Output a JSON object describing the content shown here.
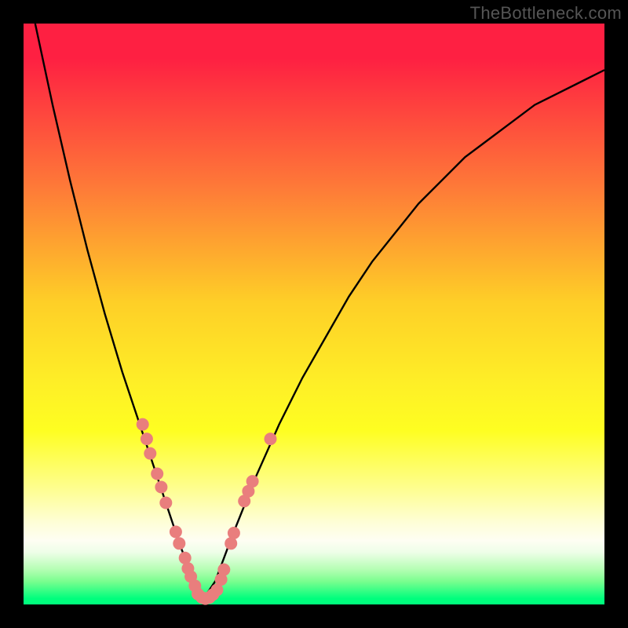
{
  "watermark": "TheBottleneck.com",
  "chart_data": {
    "type": "line",
    "title": "",
    "xlabel": "",
    "ylabel": "",
    "xlim": [
      0,
      100
    ],
    "ylim": [
      0,
      100
    ],
    "grid": false,
    "legend": false,
    "series": [
      {
        "name": "bottleneck-curve",
        "color": "#000000",
        "x": [
          2,
          5,
          8,
          11,
          14,
          17,
          19,
          21,
          23,
          25,
          27,
          29,
          31,
          33,
          36,
          40,
          44,
          48,
          52,
          56,
          60,
          64,
          68,
          72,
          76,
          80,
          84,
          88,
          92,
          96,
          100
        ],
        "y": [
          100,
          86,
          73,
          61,
          50,
          40,
          34,
          28,
          22,
          16,
          10,
          5,
          1,
          4,
          12,
          22,
          31,
          39,
          46,
          53,
          59,
          64,
          69,
          73,
          77,
          80,
          83,
          86,
          88,
          90,
          92
        ]
      }
    ],
    "scatter_clusters": [
      {
        "name": "left-arm-points",
        "color": "#e97e7d",
        "radius": 8,
        "points": [
          {
            "x": 20.5,
            "y": 31.0
          },
          {
            "x": 21.2,
            "y": 28.5
          },
          {
            "x": 21.8,
            "y": 26.0
          },
          {
            "x": 23.0,
            "y": 22.5
          },
          {
            "x": 23.7,
            "y": 20.2
          },
          {
            "x": 24.5,
            "y": 17.5
          },
          {
            "x": 26.2,
            "y": 12.5
          },
          {
            "x": 26.8,
            "y": 10.5
          },
          {
            "x": 27.8,
            "y": 8.0
          },
          {
            "x": 28.3,
            "y": 6.2
          },
          {
            "x": 28.8,
            "y": 4.8
          },
          {
            "x": 29.5,
            "y": 3.2
          }
        ]
      },
      {
        "name": "valley-points",
        "color": "#e97e7d",
        "radius": 8,
        "points": [
          {
            "x": 30.0,
            "y": 1.8
          },
          {
            "x": 30.7,
            "y": 1.2
          },
          {
            "x": 31.3,
            "y": 1.0
          },
          {
            "x": 32.0,
            "y": 1.2
          },
          {
            "x": 32.6,
            "y": 1.7
          },
          {
            "x": 33.3,
            "y": 2.5
          }
        ]
      },
      {
        "name": "right-arm-points",
        "color": "#e97e7d",
        "radius": 8,
        "points": [
          {
            "x": 34.0,
            "y": 4.3
          },
          {
            "x": 34.5,
            "y": 6.0
          },
          {
            "x": 35.7,
            "y": 10.5
          },
          {
            "x": 36.2,
            "y": 12.3
          },
          {
            "x": 38.0,
            "y": 17.8
          },
          {
            "x": 38.7,
            "y": 19.5
          },
          {
            "x": 39.4,
            "y": 21.2
          },
          {
            "x": 42.5,
            "y": 28.5
          }
        ]
      }
    ],
    "gradient_stops": [
      {
        "pos": 0.0,
        "color": "#fe2042"
      },
      {
        "pos": 0.28,
        "color": "#fe7938"
      },
      {
        "pos": 0.48,
        "color": "#fecf27"
      },
      {
        "pos": 0.7,
        "color": "#fefe21"
      },
      {
        "pos": 0.86,
        "color": "#fefed8"
      },
      {
        "pos": 0.91,
        "color": "#eefee8"
      },
      {
        "pos": 1.0,
        "color": "#00fe7d"
      }
    ]
  }
}
